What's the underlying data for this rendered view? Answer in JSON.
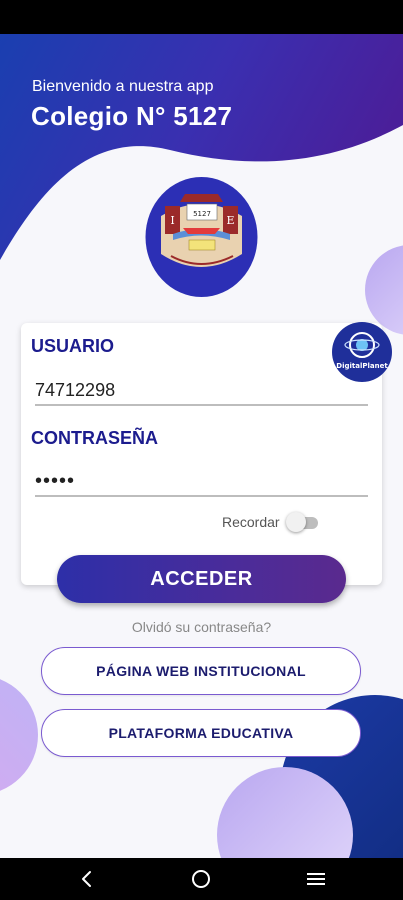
{
  "header": {
    "welcome": "Bienvenido a nuestra app",
    "title": "Colegio N° 5127"
  },
  "crest": {
    "number": "5127",
    "letters": [
      "I",
      "E"
    ]
  },
  "login": {
    "user_label": "USUARIO",
    "user_value": "74712298",
    "password_label": "CONTRASEÑA",
    "password_value": "•••••",
    "remember_label": "Recordar",
    "remember_on": false,
    "badge_text": "DigitalPlanet",
    "submit_label": "ACCEDER",
    "forgot_label": "Olvidó su contraseña?"
  },
  "links": [
    {
      "label": "PÁGINA WEB INSTITUCIONAL"
    },
    {
      "label": "PLATAFORMA EDUCATIVA"
    }
  ],
  "nav": {
    "back_icon": "back-icon",
    "home_icon": "home-icon",
    "menu_icon": "menu-icon"
  },
  "colors": {
    "primary_blue": "#1c1c8e",
    "gradient_start": "#1a3fb0",
    "gradient_end": "#4a1f9a",
    "bubble": "#c9b8f2"
  }
}
